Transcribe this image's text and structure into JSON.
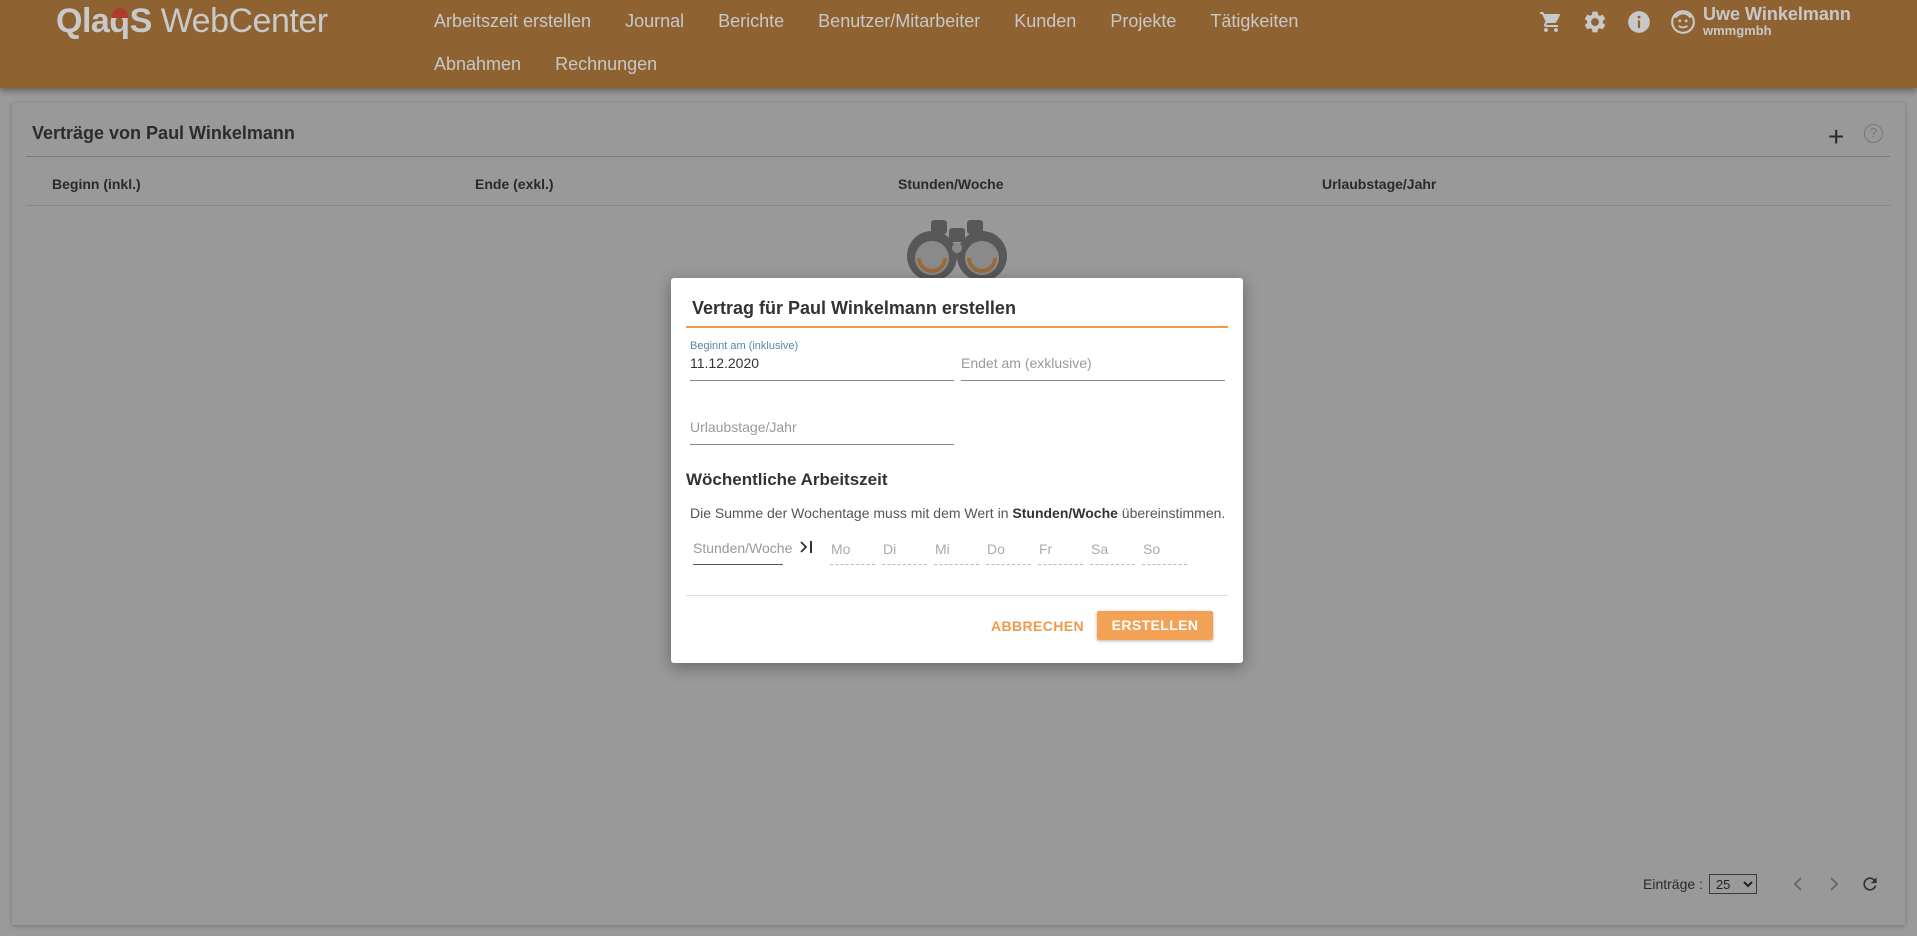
{
  "app": {
    "logo_brand": "QlaqS",
    "logo_product": "WebCenter"
  },
  "nav": {
    "row1": [
      "Arbeitszeit erstellen",
      "Journal",
      "Berichte",
      "Benutzer/Mitarbeiter",
      "Kunden",
      "Projekte",
      "Tätigkeiten"
    ],
    "row2": [
      "Abnahmen",
      "Rechnungen"
    ]
  },
  "user": {
    "name": "Uwe Winkelmann",
    "org": "wmmgmbh"
  },
  "card": {
    "title": "Verträge von Paul Winkelmann",
    "columns": [
      "Beginn (inkl.)",
      "Ende (exkl.)",
      "Stunden/Woche",
      "Urlaubstage/Jahr"
    ]
  },
  "pager": {
    "label": "Einträge :",
    "page_size": "25"
  },
  "modal": {
    "title": "Vertrag für Paul Winkelmann erstellen",
    "start_label": "Beginnt am (inklusive)",
    "start_value": "11.12.2020",
    "end_placeholder": "Endet am (exklusive)",
    "vacation_placeholder": "Urlaubstage/Jahr",
    "section_title": "Wöchentliche Arbeitszeit",
    "hint_pre": "Die Summe der Wochentage muss mit dem Wert in ",
    "hint_bold": "Stunden/Woche",
    "hint_post": " übereinstimmen.",
    "hours_placeholder": "Stunden/Woche",
    "days": [
      "Mo",
      "Di",
      "Mi",
      "Do",
      "Fr",
      "Sa",
      "So"
    ],
    "cancel_label": "ABBRECHEN",
    "create_label": "ERSTELLEN"
  },
  "colors": {
    "topbar": "#8f6232",
    "accent": "#f09a47",
    "overlay": "#9a9a9a"
  }
}
